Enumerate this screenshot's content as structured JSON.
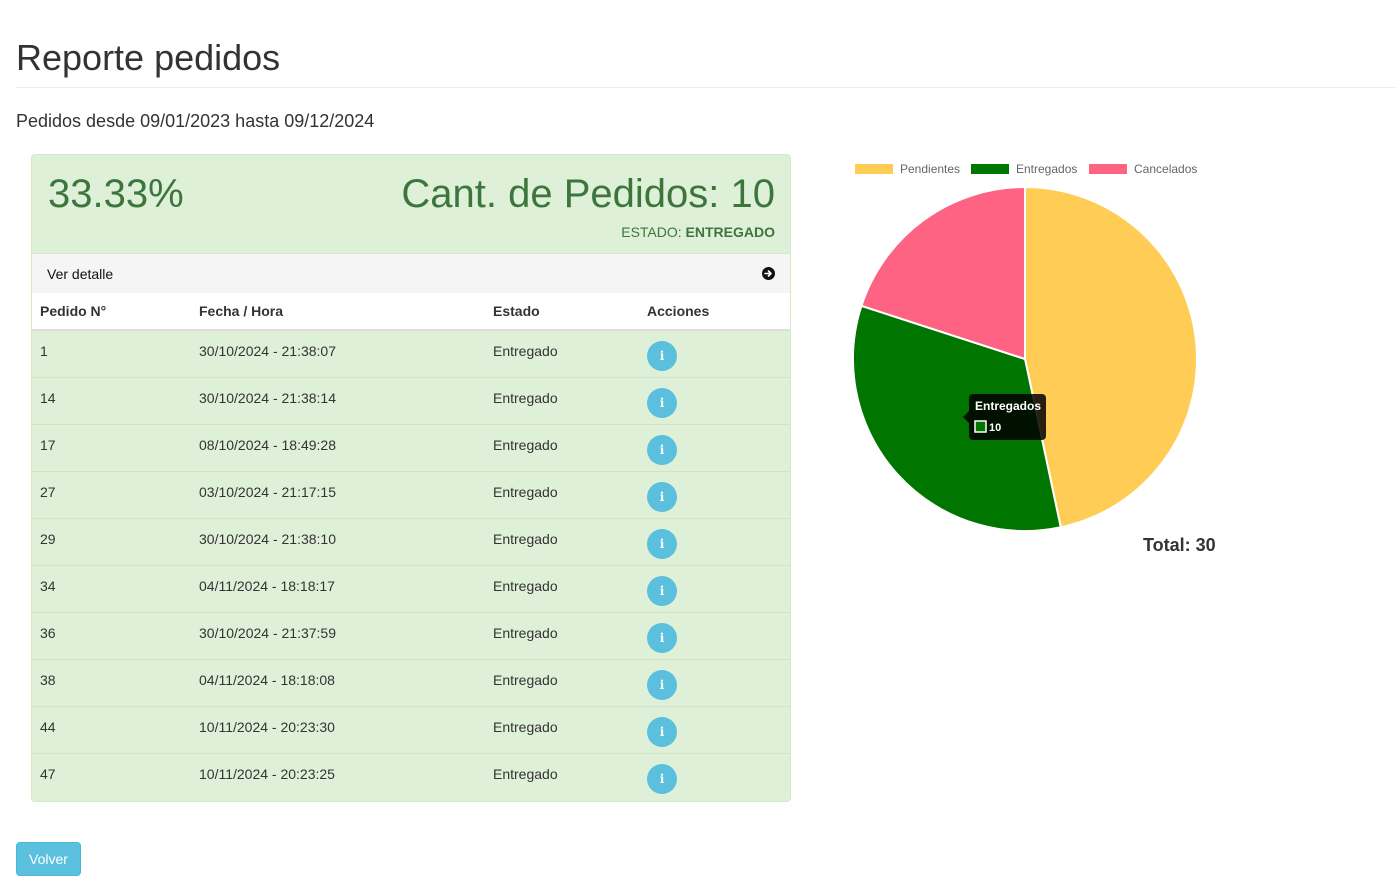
{
  "page": {
    "title": "Reporte pedidos",
    "subtitle": "Pedidos desde 09/01/2023 hasta 09/12/2024"
  },
  "panel": {
    "percent": "33.33%",
    "count": "Cant. de Pedidos: 10",
    "estado_label": "ESTADO:",
    "estado_value": "ENTREGADO",
    "detail_link": "Ver detalle"
  },
  "table": {
    "headers": [
      "Pedido N°",
      "Fecha / Hora",
      "Estado",
      "Acciones"
    ],
    "rows": [
      {
        "id": "1",
        "datetime": "30/10/2024 - 21:38:07",
        "status": "Entregado"
      },
      {
        "id": "14",
        "datetime": "30/10/2024 - 21:38:14",
        "status": "Entregado"
      },
      {
        "id": "17",
        "datetime": "08/10/2024 - 18:49:28",
        "status": "Entregado"
      },
      {
        "id": "27",
        "datetime": "03/10/2024 - 21:17:15",
        "status": "Entregado"
      },
      {
        "id": "29",
        "datetime": "30/10/2024 - 21:38:10",
        "status": "Entregado"
      },
      {
        "id": "34",
        "datetime": "04/11/2024 - 18:18:17",
        "status": "Entregado"
      },
      {
        "id": "36",
        "datetime": "30/10/2024 - 21:37:59",
        "status": "Entregado"
      },
      {
        "id": "38",
        "datetime": "04/11/2024 - 18:18:08",
        "status": "Entregado"
      },
      {
        "id": "44",
        "datetime": "10/11/2024 - 20:23:30",
        "status": "Entregado"
      },
      {
        "id": "47",
        "datetime": "10/11/2024 - 20:23:25",
        "status": "Entregado"
      }
    ],
    "action_icon": "info-icon"
  },
  "buttons": {
    "back": "Volver"
  },
  "total": "Total: 30",
  "colors": {
    "success_bg": "#dff0d8",
    "success_text": "#3c763d",
    "info": "#5bc0de",
    "pendientes": "#ffcd56",
    "entregados": "#007500",
    "cancelados": "#ff6384"
  },
  "chart_data": {
    "type": "pie",
    "categories": [
      "Pendientes",
      "Entregados",
      "Cancelados"
    ],
    "values": [
      14,
      10,
      6
    ],
    "colors": [
      "#ffcd56",
      "#007500",
      "#ff6384"
    ],
    "legend": "top",
    "tooltip": {
      "title": "Entregados",
      "value": "10"
    }
  }
}
